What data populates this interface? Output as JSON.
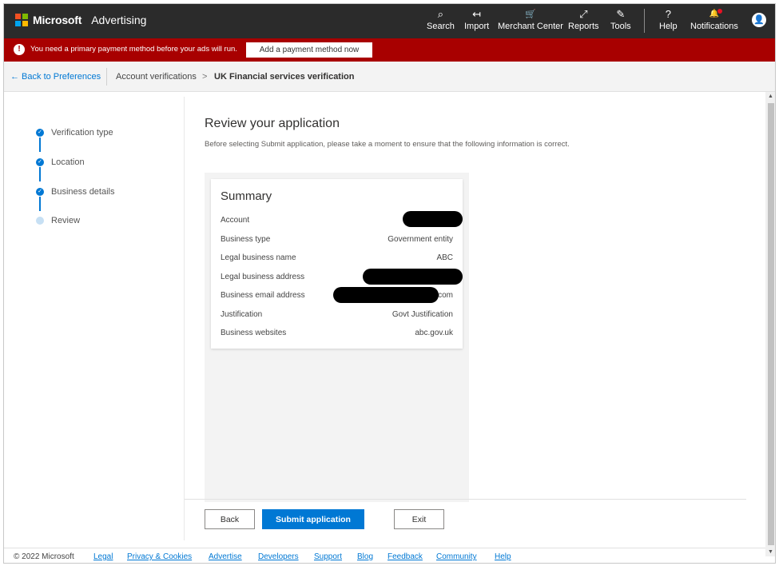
{
  "header": {
    "brand": "Microsoft",
    "product": "Advertising",
    "nav": [
      {
        "icon": "search-icon",
        "glyph": "⌕",
        "label": "Search"
      },
      {
        "icon": "import-icon",
        "glyph": "↤",
        "label": "Import"
      },
      {
        "icon": "cart-icon",
        "glyph": "🛒",
        "label": "Merchant Center"
      },
      {
        "icon": "reports-icon",
        "glyph": "⤢",
        "label": "Reports"
      },
      {
        "icon": "tools-icon",
        "glyph": "✎",
        "label": "Tools"
      },
      {
        "icon": "help-icon",
        "glyph": "?",
        "label": "Help"
      },
      {
        "icon": "bell-icon",
        "glyph": "🔔",
        "label": "Notifications"
      }
    ],
    "avatar_glyph": "👤"
  },
  "alert": {
    "icon": "!",
    "text": "You need a primary payment method before your ads will run.",
    "button": "Add a payment method now"
  },
  "breadcrumb": {
    "back": "← Back to Preferences",
    "parent": "Account verifications",
    "separator": ">",
    "current": "UK Financial services verification"
  },
  "steps": [
    {
      "label": "Verification type",
      "status": "done"
    },
    {
      "label": "Location",
      "status": "done"
    },
    {
      "label": "Business details",
      "status": "done"
    },
    {
      "label": "Review",
      "status": "current"
    }
  ],
  "main": {
    "title": "Review your application",
    "subtitle": "Before selecting Submit application, please take a moment to ensure that the following information is correct."
  },
  "summary": {
    "title": "Summary",
    "rows": [
      {
        "key": "Account",
        "value": ""
      },
      {
        "key": "Business type",
        "value": "Government entity"
      },
      {
        "key": "Legal business name",
        "value": "ABC"
      },
      {
        "key": "Legal business address",
        "value": ""
      },
      {
        "key": "Business email address",
        "value": "com"
      },
      {
        "key": "Justification",
        "value": "Govt Justification"
      },
      {
        "key": "Business websites",
        "value": "abc.gov.uk"
      }
    ]
  },
  "actions": {
    "back": "Back",
    "submit": "Submit application",
    "exit": "Exit"
  },
  "footer": {
    "copyright": "© 2022 Microsoft",
    "links": [
      "Legal",
      "Privacy & Cookies",
      "Advertise",
      "Developers",
      "Support",
      "Blog",
      "Feedback",
      "Community",
      "Help"
    ]
  },
  "colors": {
    "topbar": "#2b2b2b",
    "alert": "#a80000",
    "accent": "#0078d4"
  }
}
